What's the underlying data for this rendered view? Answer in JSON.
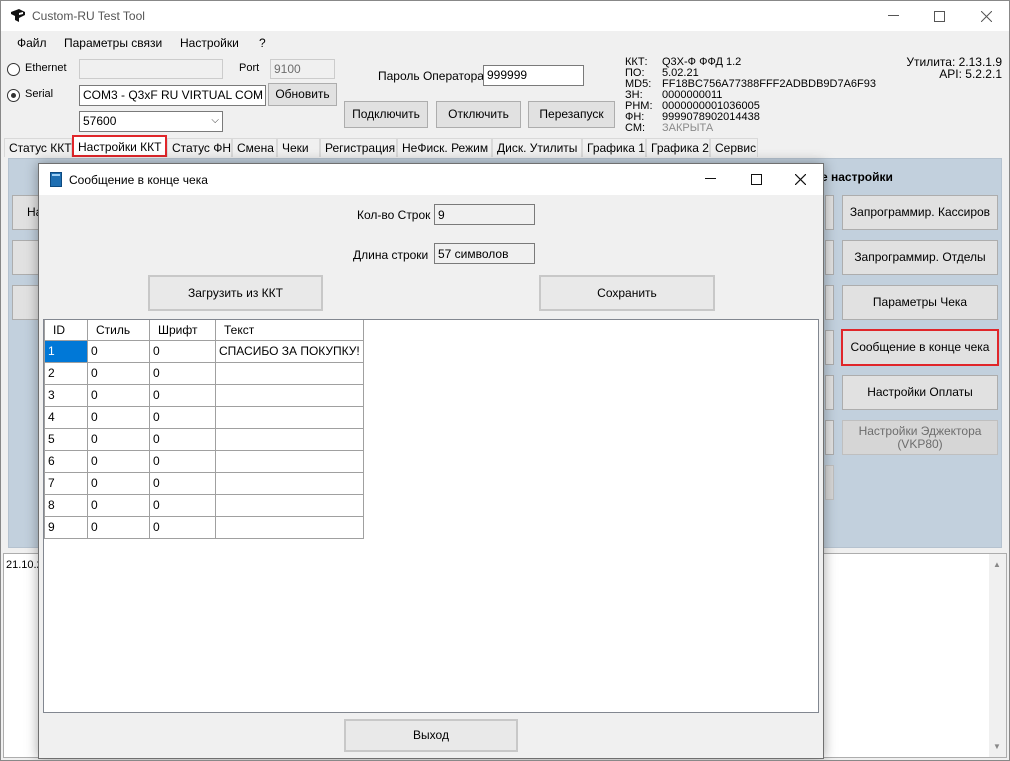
{
  "window": {
    "title": "Custom-RU Test Tool"
  },
  "menu": [
    "Файл",
    "Параметры связи",
    "Настройки",
    "?"
  ],
  "connection": {
    "ethernet_label": "Ethernet",
    "serial_label": "Serial",
    "ethernet_selected": false,
    "serial_selected": true,
    "ip_value": "",
    "port_label": "Port",
    "port_value": "9100",
    "com_port_value": "COM3 - Q3xF RU VIRTUAL COM (",
    "baud_value": "57600",
    "refresh_label": "Обновить",
    "password_label": "Пароль Оператора",
    "password_value": "999999",
    "connect_label": "Подключить",
    "disconnect_label": "Отключить",
    "restart_label": "Перезапуск"
  },
  "device_info": [
    {
      "key": "ККТ:",
      "value": "Q3X-Ф ФФД 1.2"
    },
    {
      "key": "ПО:",
      "value": "5.02.21"
    },
    {
      "key": "MD5:",
      "value": "FF18BC756A77388FFF2ADBDB9D7A6F93"
    },
    {
      "key": "ЗН:",
      "value": "0000000011"
    },
    {
      "key": "РНМ:",
      "value": "0000000001036005"
    },
    {
      "key": "ФН:",
      "value": "9999078902014438"
    },
    {
      "key": "СМ:",
      "value": "ЗАКРЫТА"
    }
  ],
  "versions": {
    "utility": "Утилита: 2.13.1.9",
    "api": "API: 5.2.2.1"
  },
  "tabs": [
    "Статус ККТ",
    "Настройки ККТ",
    "Статус ФН",
    "Смена",
    "Чеки",
    "Регистрация",
    "НеФиск. Режим",
    "Диск. Утилиты",
    "Графика 1",
    "Графика 2",
    "Сервис"
  ],
  "active_tab": "Настройки ККТ",
  "settings_panel": {
    "group_title": "е настройки",
    "left_button_partial": "На",
    "buttons": [
      "Запрограммир. Кассиров",
      "Запрограммир. Отделы",
      "Параметры Чека",
      "Сообщение в конце чека",
      "Настройки Оплаты",
      "Настройки Эджектора (VKP80)"
    ]
  },
  "log": {
    "first_line": "21.10.2"
  },
  "dialog": {
    "title": "Сообщение в конце чека",
    "lines_label": "Кол-во Строк",
    "lines_value": "9",
    "length_label": "Длина строки",
    "length_value": "57 символов",
    "load_label": "Загрузить из ККТ",
    "save_label": "Сохранить",
    "exit_label": "Выход",
    "columns": [
      "ID",
      "Стиль",
      "Шрифт",
      "Текст"
    ],
    "rows": [
      [
        "1",
        "0",
        "0",
        "СПАСИБО ЗА ПОКУПКУ!"
      ],
      [
        "2",
        "0",
        "0",
        ""
      ],
      [
        "3",
        "0",
        "0",
        ""
      ],
      [
        "4",
        "0",
        "0",
        ""
      ],
      [
        "5",
        "0",
        "0",
        ""
      ],
      [
        "6",
        "0",
        "0",
        ""
      ],
      [
        "7",
        "0",
        "0",
        ""
      ],
      [
        "8",
        "0",
        "0",
        ""
      ],
      [
        "9",
        "0",
        "0",
        ""
      ]
    ]
  }
}
